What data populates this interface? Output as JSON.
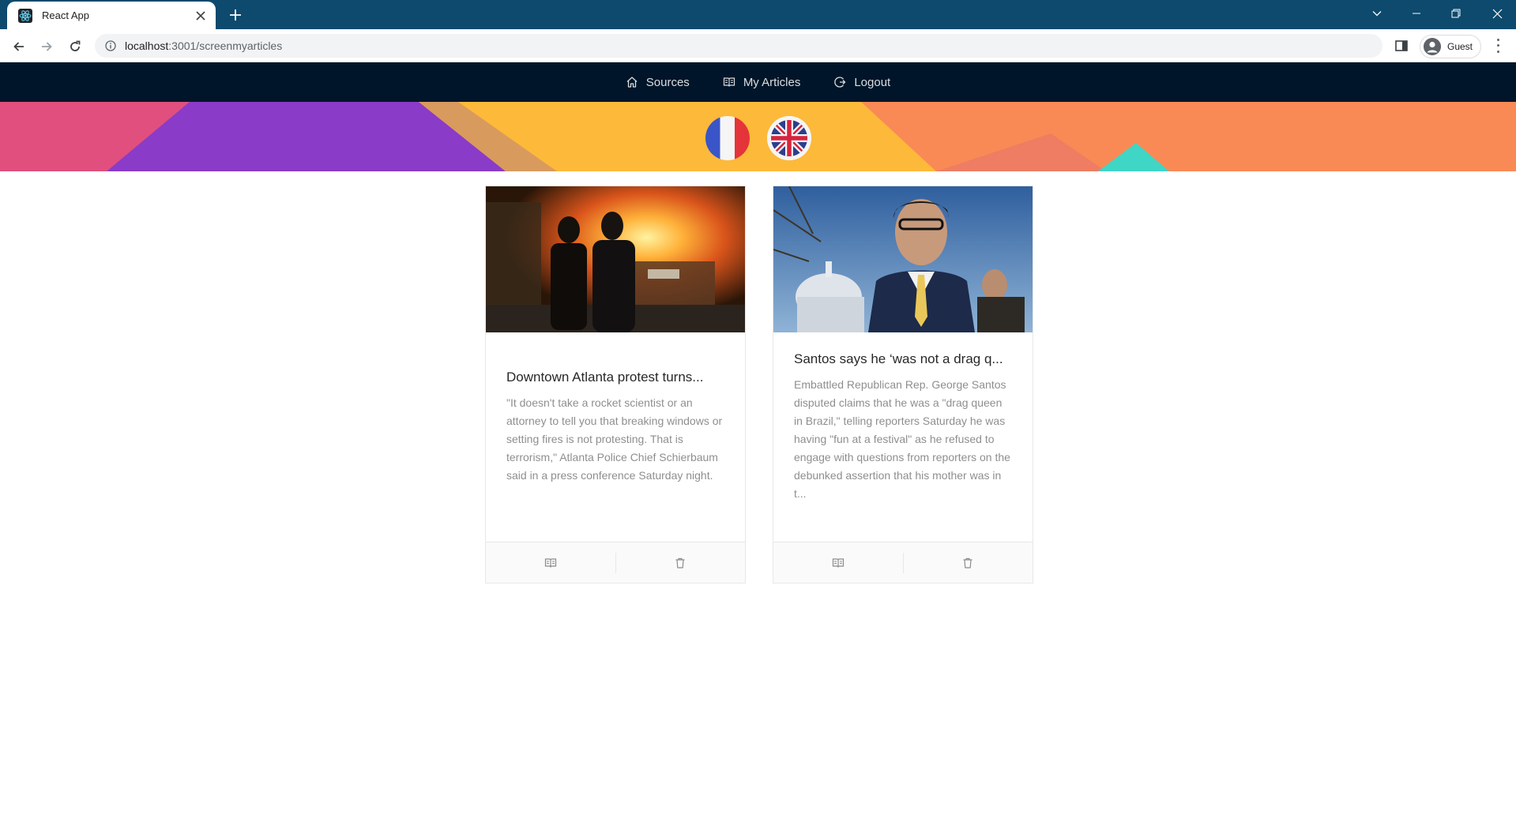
{
  "browser": {
    "tab_title": "React App",
    "url_host": "localhost",
    "url_path": ":3001/screenmyarticles",
    "profile_label": "Guest"
  },
  "nav": {
    "items": [
      {
        "label": "Sources",
        "icon": "home-icon"
      },
      {
        "label": "My Articles",
        "icon": "read-icon"
      },
      {
        "label": "Logout",
        "icon": "logout-icon"
      }
    ]
  },
  "banner": {
    "flags": [
      "france-flag",
      "united-kingdom-flag"
    ]
  },
  "articles": [
    {
      "title": "Downtown Atlanta protest turns...",
      "description": "\"It doesn't take a rocket scientist or an attorney to tell you that breaking windows or setting fires is not protesting. That is terrorism,\" Atlanta Police Chief Schierbaum said in a press conference Saturday night.",
      "actions": [
        "read-icon",
        "delete-icon"
      ]
    },
    {
      "title": "Santos says he ‘was not a drag q...",
      "description": "Embattled Republican Rep. George Santos disputed claims that he was a \"drag queen in Brazil,\" telling reporters Saturday he was having \"fun at a festival\" as he refused to engage with questions from reporters on the debunked assertion that his mother was in t...",
      "actions": [
        "read-icon",
        "delete-icon"
      ]
    }
  ],
  "colors": {
    "nav_bg": "#001529",
    "tabbar_bg": "#0d4a6e",
    "banner_pink": "#e04f7e",
    "banner_purple": "#8a3bc8",
    "banner_yellow": "#fdb93a",
    "banner_orange": "#f98a55",
    "banner_teal": "#3fd6c6"
  }
}
